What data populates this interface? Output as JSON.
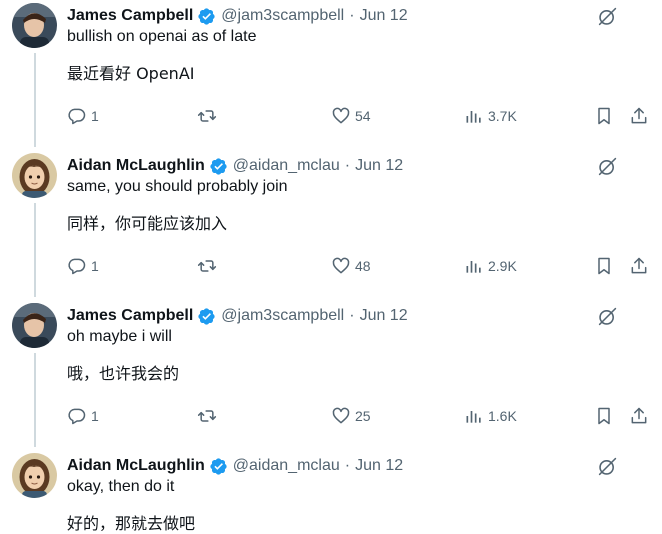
{
  "tweets": [
    {
      "name": "James Campbell",
      "handle": "@jam3scampbell",
      "dot": "·",
      "time": "Jun 12",
      "text": "bullish on openai as of late",
      "translation": "最近看好 OpenAI",
      "replies": "1",
      "likes": "54",
      "views": "3.7K"
    },
    {
      "name": "Aidan McLaughlin",
      "handle": "@aidan_mclau",
      "dot": "·",
      "time": "Jun 12",
      "text": "same, you should probably join",
      "translation": "同样，你可能应该加入",
      "replies": "1",
      "likes": "48",
      "views": "2.9K"
    },
    {
      "name": "James Campbell",
      "handle": "@jam3scampbell",
      "dot": "·",
      "time": "Jun 12",
      "text": "oh maybe i will",
      "translation": "哦，也许我会的",
      "replies": "1",
      "likes": "25",
      "views": "1.6K"
    },
    {
      "name": "Aidan McLaughlin",
      "handle": "@aidan_mclau",
      "dot": "·",
      "time": "Jun 12",
      "text": "okay, then do it",
      "translation": "好的，那就去做吧"
    }
  ],
  "colors": {
    "verified": "#1d9bf0",
    "muted": "#536471",
    "thread_line": "#cfd9de"
  },
  "icons": {
    "verified": "verified-badge-icon",
    "grok": "grok-icon",
    "reply": "reply-icon",
    "retweet": "retweet-icon",
    "like": "heart-icon",
    "views": "views-icon",
    "bookmark": "bookmark-icon",
    "share": "share-icon"
  }
}
